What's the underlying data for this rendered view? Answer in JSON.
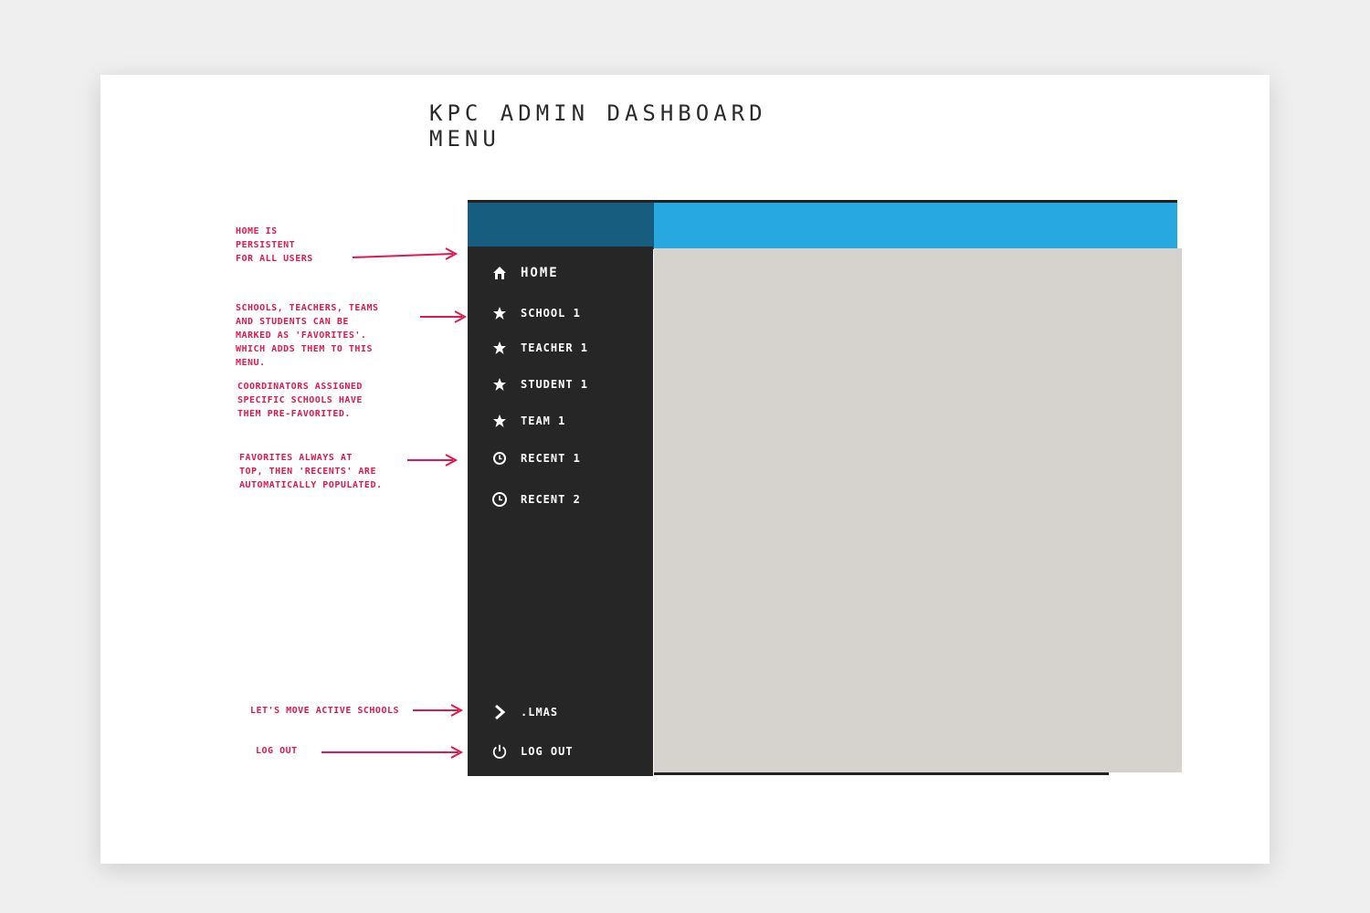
{
  "title": "KPC ADMIN DASHBOARD MENU",
  "menu": {
    "home": {
      "label": "HOME",
      "icon": "home-icon"
    },
    "favorites": [
      {
        "label": "SCHOOL 1",
        "icon": "star-icon"
      },
      {
        "label": "TEACHER 1",
        "icon": "star-icon"
      },
      {
        "label": "STUDENT 1",
        "icon": "star-icon"
      },
      {
        "label": "TEAM 1",
        "icon": "star-icon"
      }
    ],
    "recents": [
      {
        "label": "RECENT 1",
        "icon": "clock-icon"
      },
      {
        "label": "RECENT 2",
        "icon": "clock-icon"
      }
    ],
    "lmas": {
      "label": ".LMAS",
      "icon": "chevron-right-icon"
    },
    "logout": {
      "label": "LOG OUT",
      "icon": "power-icon"
    }
  },
  "annotations": {
    "home": "HOME IS\nPERSISTENT\nFOR ALL USERS",
    "favorites_1": "SCHOOLS, TEACHERS, TEAMS\nAND STUDENTS CAN BE\nMARKED AS 'FAVORITES'.\nWHICH ADDS THEM TO THIS\nMENU.",
    "favorites_2": "COORDINATORS ASSIGNED\nSPECIFIC SCHOOLS HAVE\nTHEM PRE-FAVORITED.",
    "recents": "FAVORITES ALWAYS AT\nTOP, THEN 'RECENTS' ARE\nAUTOMATICALLY POPULATED.",
    "lmas": "LET'S MOVE ACTIVE SCHOOLS",
    "logout": "LOG OUT"
  },
  "colors": {
    "header_left": "#165d80",
    "header_right": "#27a8e0",
    "sidebar": "#262626",
    "content": "#d6d3cf",
    "annotation": "#e0194d"
  }
}
